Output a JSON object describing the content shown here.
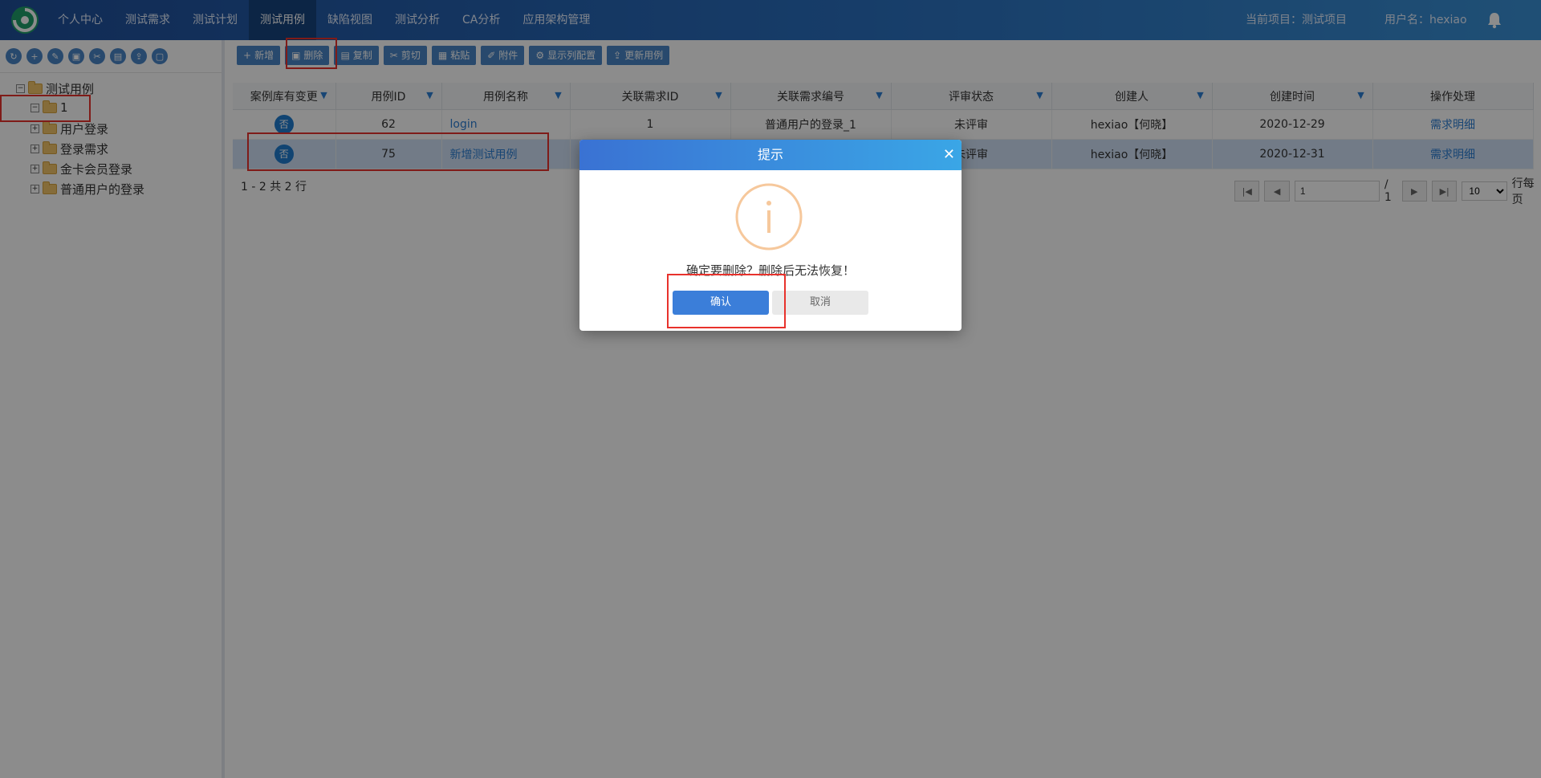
{
  "topnav": {
    "items": [
      "个人中心",
      "测试需求",
      "测试计划",
      "测试用例",
      "缺陷视图",
      "测试分析",
      "CA分析",
      "应用架构管理"
    ],
    "active_index": 3,
    "current_project": "当前项目：测试项目",
    "username": "用户名：hexiao"
  },
  "tree": {
    "root": "测试用例",
    "folder_1": "1",
    "children": [
      "用户登录",
      "登录需求",
      "金卡会员登录",
      "普通用户的登录"
    ]
  },
  "toolbar": {
    "new": "新增",
    "delete": "删除",
    "copy": "复制",
    "cut": "剪切",
    "paste": "粘贴",
    "attach": "附件",
    "columns": "显示列配置",
    "update": "更新用例"
  },
  "table": {
    "headers": [
      "案例库有变更",
      "用例ID",
      "用例名称",
      "关联需求ID",
      "关联需求编号",
      "评审状态",
      "创建人",
      "创建时间",
      "操作处理"
    ],
    "rows": [
      {
        "changed": "否",
        "id": "62",
        "name": "login",
        "req_id": "1",
        "req_no": "普通用户的登录_1",
        "status": "未评审",
        "creator": "hexiao【何晓】",
        "created": "2020-12-29",
        "action": "需求明细"
      },
      {
        "changed": "否",
        "id": "75",
        "name": "新增测试用例",
        "req_id": "",
        "req_no": "",
        "status": "未评审",
        "creator": "hexiao【何晓】",
        "created": "2020-12-31",
        "action": "需求明细"
      }
    ],
    "footer": "1 - 2 共 2 行"
  },
  "pager": {
    "page": "1",
    "total": "/ 1",
    "per_page": "10",
    "per_page_label": "行每页"
  },
  "modal": {
    "title": "提示",
    "message": "确定要删除？删除后无法恢复！",
    "ok": "确认",
    "cancel": "取消"
  }
}
